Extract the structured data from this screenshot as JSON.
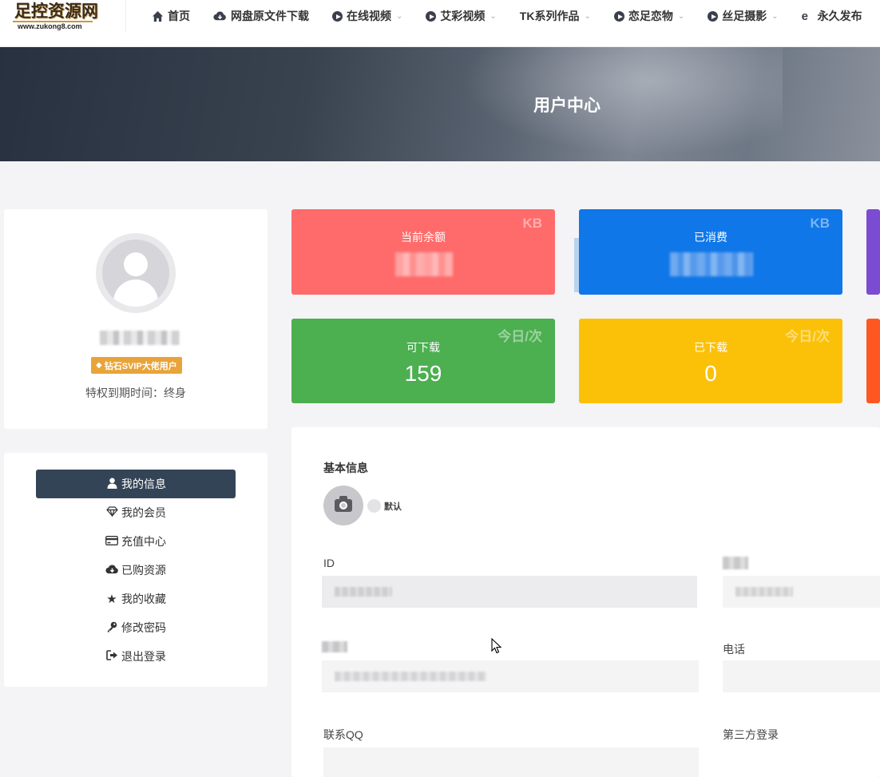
{
  "site": {
    "logo_title": "足控资源网",
    "logo_url": "www.zukong8.com"
  },
  "nav": [
    {
      "label": "首页",
      "icon": "home-icon"
    },
    {
      "label": "网盘原文件下载",
      "icon": "cloud-download-icon"
    },
    {
      "label": "在线视频",
      "icon": "play-circle-icon",
      "has_dropdown": true
    },
    {
      "label": "艾彩视频",
      "icon": "play-circle-icon",
      "has_dropdown": true
    },
    {
      "label": "TK系列作品",
      "icon": "",
      "has_dropdown": true
    },
    {
      "label": "恋足恋物",
      "icon": "play-circle-icon",
      "has_dropdown": true
    },
    {
      "label": "丝足摄影",
      "icon": "play-circle-icon",
      "has_dropdown": true
    },
    {
      "label": "永久发布",
      "icon": "ie-icon"
    }
  ],
  "banner": {
    "title": "用户中心"
  },
  "profile": {
    "vip_badge": "钻石SVIP大佬用户",
    "expire_text": "特权到期时间：终身"
  },
  "menu": [
    {
      "label": "我的信息",
      "icon": "user-icon",
      "active": true
    },
    {
      "label": "我的会员",
      "icon": "diamond-icon"
    },
    {
      "label": "充值中心",
      "icon": "credit-card-icon"
    },
    {
      "label": "已购资源",
      "icon": "cloud-download-icon"
    },
    {
      "label": "我的收藏",
      "icon": "star-icon"
    },
    {
      "label": "修改密码",
      "icon": "key-icon"
    },
    {
      "label": "退出登录",
      "icon": "sign-out-icon"
    }
  ],
  "stats": [
    {
      "label": "当前余额",
      "unit": "KB",
      "value": "",
      "color": "#ff6b6b"
    },
    {
      "label": "已消费",
      "unit": "KB",
      "value": "",
      "color": "#0f77e8"
    },
    {
      "label": "可下载",
      "unit": "今日/次",
      "value": "159",
      "color": "#4caf50"
    },
    {
      "label": "已下载",
      "unit": "今日/次",
      "value": "0",
      "color": "#fbc109"
    }
  ],
  "info": {
    "section_title": "基本信息",
    "avatar_option": "默认",
    "fields": {
      "id_label": "ID",
      "phone_label": "电话",
      "qq_label": "联系QQ",
      "third_party_label": "第三方登录"
    }
  }
}
